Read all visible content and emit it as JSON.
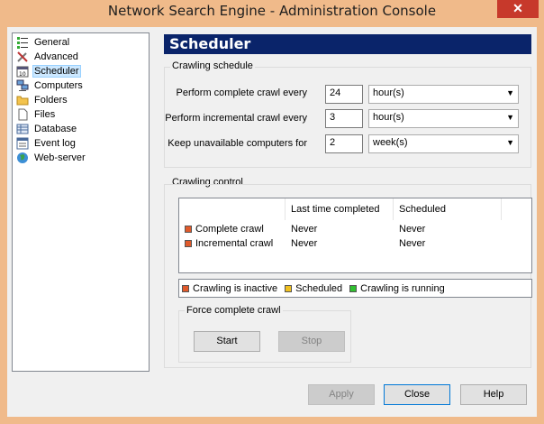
{
  "window": {
    "title": "Network Search Engine - Administration Console",
    "close_symbol": "✕"
  },
  "nav": {
    "items": [
      {
        "label": "General",
        "icon": "general-icon"
      },
      {
        "label": "Advanced",
        "icon": "tools-icon"
      },
      {
        "label": "Scheduler",
        "icon": "scheduler-icon",
        "selected": true
      },
      {
        "label": "Computers",
        "icon": "computers-icon"
      },
      {
        "label": "Folders",
        "icon": "folder-icon"
      },
      {
        "label": "Files",
        "icon": "file-icon"
      },
      {
        "label": "Database",
        "icon": "database-icon"
      },
      {
        "label": "Event log",
        "icon": "event-log-icon"
      },
      {
        "label": "Web-server",
        "icon": "globe-icon"
      }
    ]
  },
  "panel": {
    "title": "Scheduler"
  },
  "crawling_schedule": {
    "title": "Crawling schedule",
    "rows": [
      {
        "label": "Perform complete crawl every",
        "value": "24",
        "unit": "hour(s)"
      },
      {
        "label": "Perform incremental crawl every",
        "value": "3",
        "unit": "hour(s)"
      },
      {
        "label": "Keep unavailable computers for",
        "value": "2",
        "unit": "week(s)"
      }
    ],
    "arrow": "▼"
  },
  "crawling_control": {
    "title": "Crawling control",
    "headers": [
      "",
      "Last time completed",
      "Scheduled"
    ],
    "rows": [
      {
        "name": "Complete crawl",
        "last": "Never",
        "scheduled": "Never"
      },
      {
        "name": "Incremental crawl",
        "last": "Never",
        "scheduled": "Never"
      }
    ],
    "legend": [
      {
        "label": "Crawling is inactive",
        "color": "#e05a2b"
      },
      {
        "label": "Scheduled",
        "color": "#f0c020"
      },
      {
        "label": "Crawling is running",
        "color": "#30c030"
      }
    ]
  },
  "force_crawl": {
    "title": "Force complete crawl",
    "start": "Start",
    "stop": "Stop"
  },
  "buttons": {
    "apply": "Apply",
    "close": "Close",
    "help": "Help"
  }
}
